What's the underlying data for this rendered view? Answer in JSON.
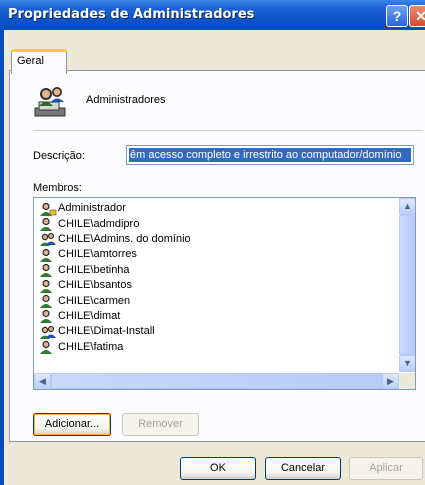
{
  "window": {
    "title": "Propriedades de Administradores",
    "help_glyph": "?",
    "close_glyph": "✕"
  },
  "tabs": [
    {
      "label": "Geral"
    }
  ],
  "group": {
    "name": "Administradores",
    "icon": "group-users-icon"
  },
  "description": {
    "label": "Descrição:",
    "value": "êm acesso completo e irrestrito ao computador/domínio"
  },
  "members": {
    "label": "Membros:",
    "items": [
      {
        "name": "Administrador",
        "icon": "user-icon"
      },
      {
        "name": "CHILE\\admdipro",
        "icon": "user-icon"
      },
      {
        "name": "CHILE\\Admins. do domínio",
        "icon": "group-icon"
      },
      {
        "name": "CHILE\\amtorres",
        "icon": "user-icon"
      },
      {
        "name": "CHILE\\betinha",
        "icon": "user-icon"
      },
      {
        "name": "CHILE\\bsantos",
        "icon": "user-icon"
      },
      {
        "name": "CHILE\\carmen",
        "icon": "user-icon"
      },
      {
        "name": "CHILE\\dimat",
        "icon": "user-icon"
      },
      {
        "name": "CHILE\\Dimat-Install",
        "icon": "group-icon"
      },
      {
        "name": "CHILE\\fatima",
        "icon": "user-icon"
      }
    ]
  },
  "buttons": {
    "add": "Adicionar...",
    "remove": "Remover",
    "ok": "OK",
    "cancel": "Cancelar",
    "apply": "Aplicar"
  }
}
